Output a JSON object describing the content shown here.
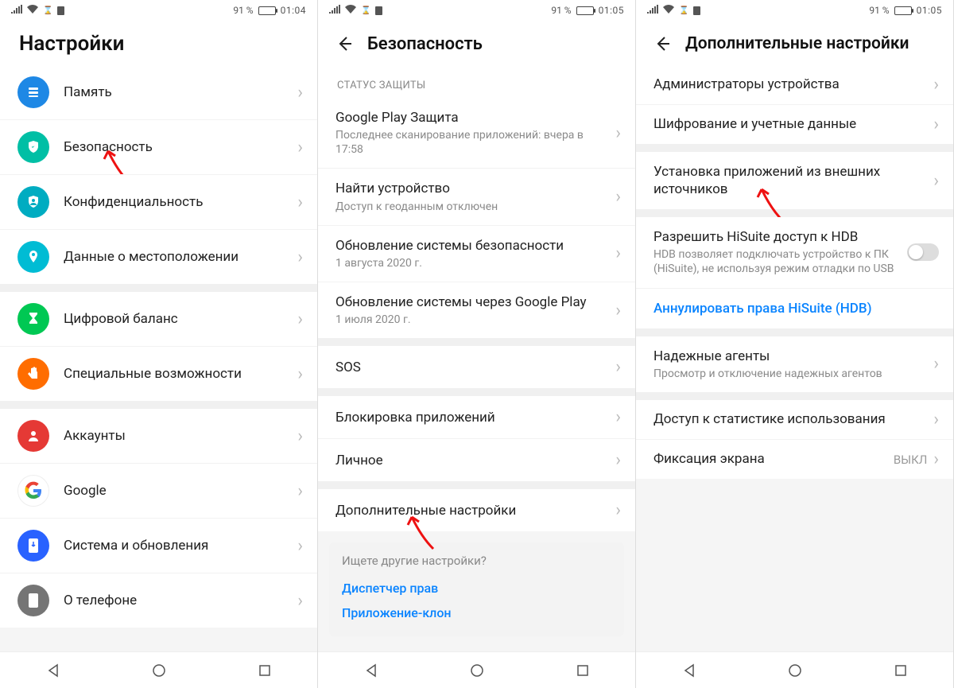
{
  "status": {
    "battery": "91 %",
    "time1": "01:04",
    "time2": "01:05",
    "time3": "01:05"
  },
  "screen1": {
    "title": "Настройки",
    "items": [
      {
        "label": "Память"
      },
      {
        "label": "Безопасность"
      },
      {
        "label": "Конфиденциальность"
      },
      {
        "label": "Данные о местоположении"
      },
      {
        "label": "Цифровой баланс"
      },
      {
        "label": "Специальные возможности"
      },
      {
        "label": "Аккаунты"
      },
      {
        "label": "Google"
      },
      {
        "label": "Система и обновления"
      },
      {
        "label": "О телефоне"
      }
    ]
  },
  "screen2": {
    "title": "Безопасность",
    "section_label": "СТАТУС ЗАЩИТЫ",
    "items": {
      "play_protect": {
        "title": "Google Play Защита",
        "subtitle": "Последнее сканирование приложений: вчера в 17:58"
      },
      "find_device": {
        "title": "Найти устройство",
        "subtitle": "Доступ к геоданным отключен"
      },
      "sec_update": {
        "title": "Обновление системы безопасности",
        "subtitle": "1 августа 2020 г."
      },
      "gplay_update": {
        "title": "Обновление системы через Google Play",
        "subtitle": "1 июля 2020 г."
      },
      "sos": {
        "title": "SOS"
      },
      "app_lock": {
        "title": "Блокировка приложений"
      },
      "personal": {
        "title": "Личное"
      },
      "more": {
        "title": "Дополнительные настройки"
      }
    },
    "hint": {
      "title": "Ищете другие настройки?",
      "link1": "Диспетчер прав",
      "link2": "Приложение-клон"
    }
  },
  "screen3": {
    "title": "Дополнительные настройки",
    "items": {
      "admins": {
        "title": "Администраторы устройства"
      },
      "encryption": {
        "title": "Шифрование и учетные данные"
      },
      "unknown": {
        "title": "Установка приложений из внешних источников"
      },
      "hdb": {
        "title": "Разрешить HiSuite доступ к HDB",
        "subtitle": "HDB позволяет подключать устройство к ПК (HiSuite), не используя режим отладки по USB"
      },
      "revoke": {
        "title": "Аннулировать права HiSuite (HDB)"
      },
      "trusted": {
        "title": "Надежные агенты",
        "subtitle": "Просмотр и отключение надежных агентов"
      },
      "usage": {
        "title": "Доступ к статистике использования"
      },
      "pin": {
        "title": "Фиксация экрана",
        "value": "ВЫКЛ"
      }
    }
  }
}
